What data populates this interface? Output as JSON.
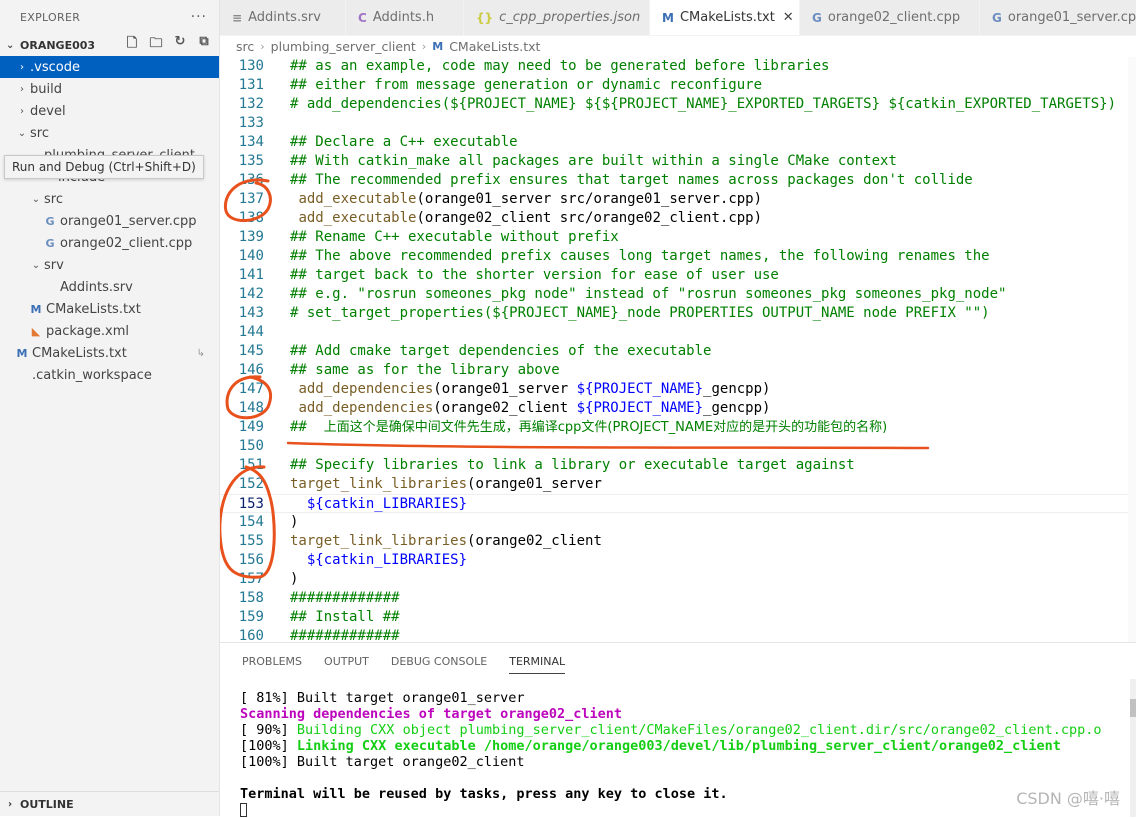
{
  "sidebar": {
    "title": "EXPLORER",
    "more": "···",
    "project": "ORANGE003",
    "actions": [
      "new-file",
      "new-folder",
      "refresh",
      "collapse-all"
    ],
    "items": [
      {
        "label": ".vscode",
        "kind": "folder",
        "expanded": false,
        "selected": true
      },
      {
        "label": "build",
        "kind": "folder",
        "expanded": false
      },
      {
        "label": "devel",
        "kind": "folder",
        "expanded": false
      },
      {
        "label": "src",
        "kind": "folder",
        "expanded": true
      },
      {
        "label": "plumbing_server_client",
        "kind": "folder",
        "expanded": true
      },
      {
        "label": "include",
        "kind": "folder",
        "expanded": false
      },
      {
        "label": "src",
        "kind": "folder",
        "expanded": true
      },
      {
        "label": "orange01_server.cpp",
        "kind": "cpp"
      },
      {
        "label": "orange02_client.cpp",
        "kind": "cpp"
      },
      {
        "label": "srv",
        "kind": "folder",
        "expanded": true
      },
      {
        "label": "Addints.srv",
        "kind": "generic"
      },
      {
        "label": "CMakeLists.txt",
        "kind": "cmake"
      },
      {
        "label": "package.xml",
        "kind": "rss"
      },
      {
        "label": "CMakeLists.txt",
        "kind": "cmake",
        "badge": "↳"
      },
      {
        "label": ".catkin_workspace",
        "kind": "generic"
      }
    ],
    "tooltip": "Run and Debug (Ctrl+Shift+D)",
    "outline": "OUTLINE"
  },
  "tabs": [
    {
      "label": "Addints.srv",
      "icon": "≡",
      "kind": "lines"
    },
    {
      "label": "Addints.h",
      "icon": "C",
      "kind": "c"
    },
    {
      "label": "c_cpp_properties.json",
      "icon": "{}",
      "kind": "json",
      "italic": true
    },
    {
      "label": "CMakeLists.txt",
      "icon": "M",
      "kind": "cmake",
      "active": true,
      "close": "✕"
    },
    {
      "label": "orange02_client.cpp",
      "icon": "G",
      "kind": "cpp"
    },
    {
      "label": "orange01_server.cpp",
      "icon": "G",
      "kind": "cpp"
    }
  ],
  "breadcrumb": {
    "parts": [
      "src",
      "plumbing_server_client"
    ],
    "file": "CMakeLists.txt",
    "file_icon": "M"
  },
  "editor": {
    "current_line": "153",
    "lines": [
      {
        "n": "130",
        "t": [
          [
            "c",
            "## as an example, code may need to be generated before libraries"
          ]
        ]
      },
      {
        "n": "131",
        "t": [
          [
            "c",
            "## either from message generation or dynamic reconfigure"
          ]
        ]
      },
      {
        "n": "132",
        "t": [
          [
            "c",
            "# add_dependencies(${PROJECT_NAME} ${${PROJECT_NAME}_EXPORTED_TARGETS} ${catkin_EXPORTED_TARGETS})"
          ]
        ]
      },
      {
        "n": "133",
        "t": []
      },
      {
        "n": "134",
        "t": [
          [
            "c",
            "## Declare a C++ executable"
          ]
        ]
      },
      {
        "n": "135",
        "t": [
          [
            "c",
            "## With catkin_make all packages are built within a single CMake context"
          ]
        ]
      },
      {
        "n": "136",
        "t": [
          [
            "c",
            "## The recommended prefix ensures that target names across packages don't collide"
          ]
        ]
      },
      {
        "n": "137",
        "t": [
          [
            "p",
            " "
          ],
          [
            "f",
            "add_executable"
          ],
          [
            "p",
            "(orange01_server src/orange01_server.cpp)"
          ]
        ]
      },
      {
        "n": "138",
        "t": [
          [
            "p",
            " "
          ],
          [
            "f",
            "add_executable"
          ],
          [
            "p",
            "(orange02_client src/orange02_client.cpp)"
          ]
        ]
      },
      {
        "n": "139",
        "t": [
          [
            "c",
            "## Rename C++ executable without prefix"
          ]
        ]
      },
      {
        "n": "140",
        "t": [
          [
            "c",
            "## The above recommended prefix causes long target names, the following renames the"
          ]
        ]
      },
      {
        "n": "141",
        "t": [
          [
            "c",
            "## target back to the shorter version for ease of user use"
          ]
        ]
      },
      {
        "n": "142",
        "t": [
          [
            "c",
            "## e.g. \"rosrun someones_pkg node\" instead of \"rosrun someones_pkg someones_pkg_node\""
          ]
        ]
      },
      {
        "n": "143",
        "t": [
          [
            "c",
            "# set_target_properties(${PROJECT_NAME}_node PROPERTIES OUTPUT_NAME node PREFIX \"\")"
          ]
        ]
      },
      {
        "n": "144",
        "t": []
      },
      {
        "n": "145",
        "t": [
          [
            "c",
            "## Add cmake target dependencies of the executable"
          ]
        ]
      },
      {
        "n": "146",
        "t": [
          [
            "c",
            "## same as for the library above"
          ]
        ]
      },
      {
        "n": "147",
        "t": [
          [
            "p",
            " "
          ],
          [
            "f",
            "add_dependencies"
          ],
          [
            "p",
            "(orange01_server "
          ],
          [
            "v",
            "${PROJECT_NAME}"
          ],
          [
            "p",
            "_gencpp)"
          ]
        ]
      },
      {
        "n": "148",
        "t": [
          [
            "p",
            " "
          ],
          [
            "f",
            "add_dependencies"
          ],
          [
            "p",
            "(orange02_client "
          ],
          [
            "v",
            "${PROJECT_NAME}"
          ],
          [
            "p",
            "_gencpp)"
          ]
        ]
      },
      {
        "n": "149",
        "t": [
          [
            "c",
            "##  "
          ],
          [
            "z",
            "上面这个是确保中间文件先生成，再编译cpp文件(PROJECT_NAME对应的是开头的功能包的名称)"
          ]
        ]
      },
      {
        "n": "150",
        "t": []
      },
      {
        "n": "151",
        "t": [
          [
            "c",
            "## Specify libraries to link a library or executable target against"
          ]
        ]
      },
      {
        "n": "152",
        "t": [
          [
            "f",
            "target_link_libraries"
          ],
          [
            "p",
            "(orange01_server"
          ]
        ]
      },
      {
        "n": "153",
        "t": [
          [
            "p",
            "  "
          ],
          [
            "v",
            "${catkin_LIBRARIES}"
          ]
        ]
      },
      {
        "n": "154",
        "t": [
          [
            "p",
            ")"
          ]
        ]
      },
      {
        "n": "155",
        "t": [
          [
            "f",
            "target_link_libraries"
          ],
          [
            "p",
            "(orange02_client"
          ]
        ]
      },
      {
        "n": "156",
        "t": [
          [
            "p",
            "  "
          ],
          [
            "v",
            "${catkin_LIBRARIES}"
          ]
        ]
      },
      {
        "n": "157",
        "t": [
          [
            "p",
            ")"
          ]
        ]
      },
      {
        "n": "158",
        "t": [
          [
            "c",
            "#############"
          ]
        ]
      },
      {
        "n": "159",
        "t": [
          [
            "c",
            "## Install ##"
          ]
        ]
      },
      {
        "n": "160",
        "t": [
          [
            "c",
            "#############"
          ]
        ]
      }
    ]
  },
  "panel": {
    "tabs": [
      "PROBLEMS",
      "OUTPUT",
      "DEBUG CONSOLE",
      "TERMINAL"
    ],
    "active_tab": "TERMINAL",
    "terminal": [
      [
        [
          "n",
          "[ 81%] Built target orange01_server"
        ]
      ],
      [
        [
          "m",
          "Scanning dependencies of target orange02_client"
        ]
      ],
      [
        [
          "n",
          "[ 90%] "
        ],
        [
          "g",
          "Building CXX object plumbing_server_client/CMakeFiles/orange02_client.dir/src/orange02_client.cpp.o"
        ]
      ],
      [
        [
          "n",
          "[100%] "
        ],
        [
          "gb",
          "Linking CXX executable /home/orange/orange003/devel/lib/plumbing_server_client/orange02_client"
        ]
      ],
      [
        [
          "n",
          "[100%] Built target orange02_client"
        ]
      ],
      [],
      [
        [
          "b",
          "Terminal will be reused by tasks, press any key to close it."
        ]
      ]
    ]
  },
  "watermark": "CSDN @嘻·嘻",
  "colors": {
    "selection": "#0060c0",
    "comment": "#008000",
    "function": "#795e26",
    "variable": "#0000ff",
    "annotation": "#e8501c"
  }
}
